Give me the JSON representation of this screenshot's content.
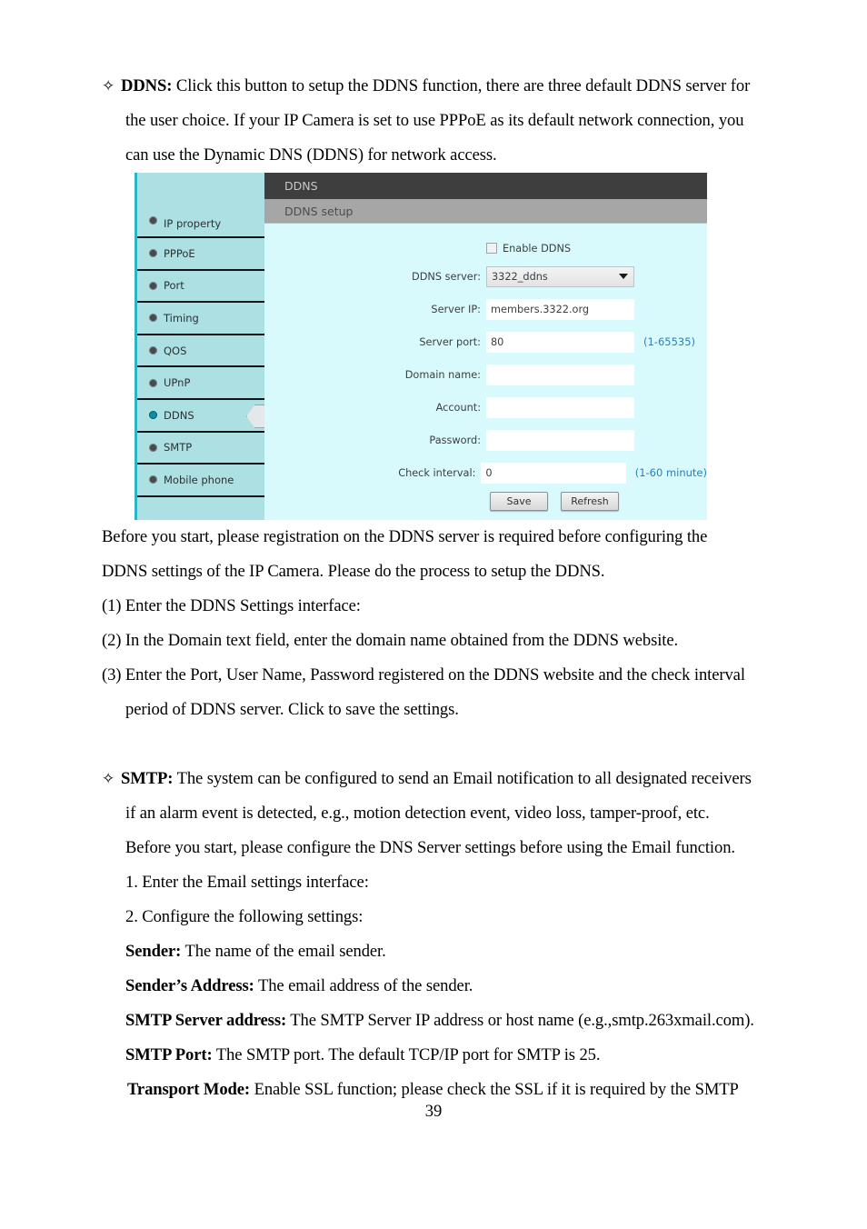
{
  "page": {
    "number": "39"
  },
  "sections": {
    "ddns": {
      "marker": "✧",
      "term": "DDNS:",
      "lines": [
        "Click this button to setup the DDNS function, there are three default DDNS server for",
        "the user choice.    If your IP Camera is set to use PPPoE as its default network connection, you",
        "can use the Dynamic DNS (DDNS) for network access."
      ],
      "after_lines": [
        "Before you start, please registration on the DDNS server is required before configuring the",
        "DDNS settings of the IP Camera.    Please do the process to setup the DDNS.",
        "(1) Enter the DDNS Settings interface:",
        "(2) In the Domain text field, enter the domain name obtained from the DDNS website.",
        "(3) Enter the Port, User Name, Password registered on the DDNS website and the check interval",
        "period of DDNS server.    Click to save the settings."
      ]
    },
    "smtp": {
      "marker": "✧",
      "term": "SMTP:",
      "lines": [
        "The system can be configured to send an Email notification to all designated receivers",
        "if an alarm event is detected, e.g., motion detection event, video loss, tamper-proof, etc.",
        "Before you start, please configure the DNS Server settings before using the Email function.",
        "1. Enter the Email settings interface:",
        "2. Configure the following settings:"
      ],
      "definitions": [
        {
          "term": "Sender:",
          "desc": " The name of the email sender."
        },
        {
          "term": "Sender’s Address:",
          "desc": " The email address of the sender."
        },
        {
          "term": "SMTP Server address:",
          "desc": " The SMTP Server IP address or host name (e.g.,smtp.263xmail.com)."
        },
        {
          "term": "SMTP Port:",
          "desc": " The SMTP port. The default TCP/IP port for SMTP is 25."
        },
        {
          "term": "Transport Mode:",
          "desc": " Enable SSL function; please check the SSL if it is required by the SMTP"
        }
      ]
    }
  },
  "ui_screenshot": {
    "title": "DDNS",
    "subtitle": "DDNS setup",
    "sidebar": {
      "items": [
        {
          "label": "IP property",
          "selected": false
        },
        {
          "label": "PPPoE",
          "selected": false
        },
        {
          "label": "Port",
          "selected": false
        },
        {
          "label": "Timing",
          "selected": false
        },
        {
          "label": "QOS",
          "selected": false
        },
        {
          "label": "UPnP",
          "selected": false
        },
        {
          "label": "DDNS",
          "selected": true
        },
        {
          "label": "SMTP",
          "selected": false
        },
        {
          "label": "Mobile phone",
          "selected": false
        }
      ]
    },
    "form": {
      "enable_checkbox": {
        "label": "Enable DDNS",
        "checked": false
      },
      "fields": [
        {
          "label": "DDNS server:",
          "value": "3322_ddns",
          "hint": "",
          "type": "select"
        },
        {
          "label": "Server IP:",
          "value": "members.3322.org",
          "hint": "",
          "type": "text"
        },
        {
          "label": "Server port:",
          "value": "80",
          "hint": "(1-65535)",
          "type": "text"
        },
        {
          "label": "Domain name:",
          "value": "",
          "hint": "",
          "type": "text"
        },
        {
          "label": "Account:",
          "value": "",
          "hint": "",
          "type": "text"
        },
        {
          "label": "Password:",
          "value": "",
          "hint": "",
          "type": "text"
        },
        {
          "label": "Check interval:",
          "value": "0",
          "hint": "(1-60 minute)",
          "type": "text"
        }
      ],
      "buttons": [
        {
          "label": "Save"
        },
        {
          "label": "Refresh"
        }
      ]
    },
    "colors": {
      "sidebar_bg": "#ade0e3",
      "content_bg": "#d8fafd",
      "titlebar_bg": "#3e3e3e",
      "subbar_bg": "#a6a6a6",
      "hint_text": "#2b7fb8",
      "selected_dot": "#0a8ea6",
      "accent_strip": "#2bb5c4"
    }
  }
}
